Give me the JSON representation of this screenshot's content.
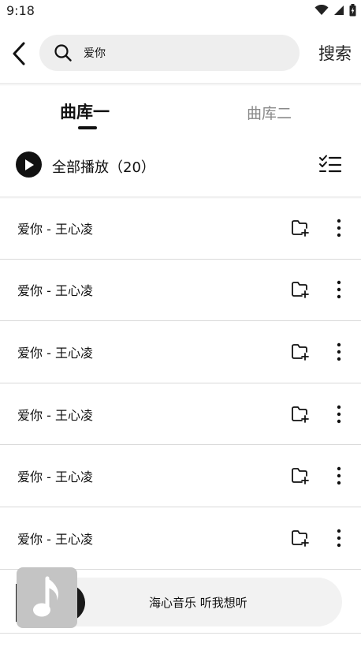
{
  "status_bar": {
    "time": "9:18"
  },
  "search": {
    "query": "爱你",
    "button_label": "搜索"
  },
  "tabs": [
    {
      "label": "曲库一",
      "active": true
    },
    {
      "label": "曲库二",
      "active": false
    }
  ],
  "play_all": {
    "label": "全部播放",
    "count_text": "（20）"
  },
  "songs": [
    {
      "title": "爱你 - 王心凌"
    },
    {
      "title": "爱你 - 王心凌"
    },
    {
      "title": "爱你 - 王心凌"
    },
    {
      "title": "爱你 - 王心凌"
    },
    {
      "title": "爱你 - 王心凌"
    },
    {
      "title": "爱你 - 王心凌"
    }
  ],
  "mini_player": {
    "now_playing": "海心音乐 听我想听"
  },
  "icons": {
    "back": "chevron-left-icon",
    "search": "search-icon",
    "play": "play-icon",
    "multi_select": "checklist-icon",
    "add": "add-to-playlist-icon",
    "more": "more-vertical-icon",
    "music_note": "music-note-icon"
  },
  "colors": {
    "accent": "#111111",
    "inactive_tab": "#888888",
    "search_bg": "#eeeeee",
    "divider": "#d9d9d9"
  }
}
